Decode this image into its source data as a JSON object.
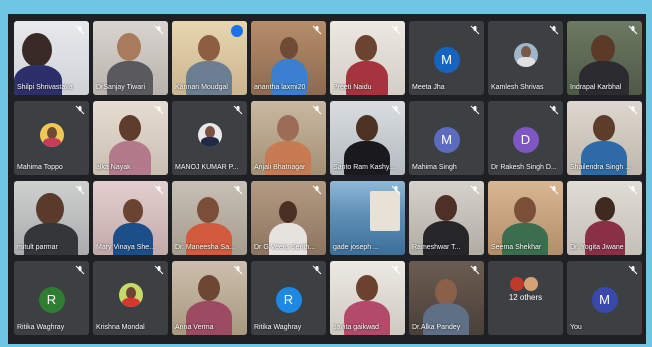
{
  "participants": [
    {
      "name": "Shilpi Shrivastava"
    },
    {
      "name": "DrSanjay Tiwari"
    },
    {
      "name": "Kannan Moudgal"
    },
    {
      "name": "anantha laxmi20"
    },
    {
      "name": "Preeti Naidu"
    },
    {
      "name": "Meeta Jha",
      "initial": "M",
      "color": "#1565c0"
    },
    {
      "name": "Kamlesh Shrivas"
    },
    {
      "name": "Indrapal Karbhal"
    },
    {
      "name": "Mahima Toppo"
    },
    {
      "name": "alka Nayak"
    },
    {
      "name": "MANOJ KUMAR P..."
    },
    {
      "name": "Anjali Bhatnagar"
    },
    {
      "name": "Santo Ram Kashy..."
    },
    {
      "name": "Mahima Singh",
      "initial": "M",
      "color": "#5c6bc0"
    },
    {
      "name": "Dr Rakesh Singh D...",
      "initial": "D",
      "color": "#7e57c2"
    },
    {
      "name": "Shailendra Singh ..."
    },
    {
      "name": "mitult parmar"
    },
    {
      "name": "Mary Vinaya She..."
    },
    {
      "name": "Dr. Maneesha Sa..."
    },
    {
      "name": "Dr G Veera Senth..."
    },
    {
      "name": "gade joseph ..."
    },
    {
      "name": "Rameshwar T..."
    },
    {
      "name": "Seema Shekhar"
    },
    {
      "name": "Dr. Yogita Jiwane"
    },
    {
      "name": "Ritika Waghray",
      "initial": "R",
      "color": "#2e7d32"
    },
    {
      "name": "Krishna Mondal"
    },
    {
      "name": "Anna Verma"
    },
    {
      "name": "Ritika Waghray",
      "initial": "R",
      "color": "#1e88e5"
    },
    {
      "name": "savita gaikwad"
    },
    {
      "name": "Dr.Alka Pandey"
    },
    {
      "name": "12 others"
    },
    {
      "name": "You",
      "initial": "M",
      "color": "#3949ab"
    }
  ],
  "icons": {
    "mic": "mic-off-icon",
    "speaking": "audio-indicator-icon"
  }
}
